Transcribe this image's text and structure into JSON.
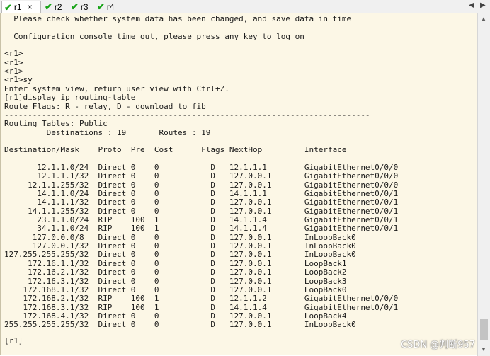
{
  "tabs": [
    {
      "label": "r1",
      "active": true,
      "close": "×"
    },
    {
      "label": "r2"
    },
    {
      "label": "r3"
    },
    {
      "label": "r4"
    }
  ],
  "nav": {
    "left": "◀",
    "right": "▶"
  },
  "terminal": {
    "lines": [
      "  Please check whether system data has been changed, and save data in time",
      "",
      "  Configuration console time out, please press any key to log on",
      "",
      "<r1>",
      "<r1>",
      "<r1>",
      "<r1>sy",
      "Enter system view, return user view with Ctrl+Z.",
      "[r1]display ip routing-table",
      "Route Flags: R - relay, D - download to fib",
      "------------------------------------------------------------------------------",
      "Routing Tables: Public",
      "         Destinations : 19       Routes : 19",
      "",
      "Destination/Mask    Proto  Pre  Cost      Flags NextHop         Interface",
      "",
      "       12.1.1.0/24  Direct 0    0           D   12.1.1.1        GigabitEthernet0/0/0",
      "       12.1.1.1/32  Direct 0    0           D   127.0.0.1       GigabitEthernet0/0/0",
      "     12.1.1.255/32  Direct 0    0           D   127.0.0.1       GigabitEthernet0/0/0",
      "       14.1.1.0/24  Direct 0    0           D   14.1.1.1        GigabitEthernet0/0/1",
      "       14.1.1.1/32  Direct 0    0           D   127.0.0.1       GigabitEthernet0/0/1",
      "     14.1.1.255/32  Direct 0    0           D   127.0.0.1       GigabitEthernet0/0/1",
      "       23.1.1.0/24  RIP    100  1           D   14.1.1.4        GigabitEthernet0/0/1",
      "       34.1.1.0/24  RIP    100  1           D   14.1.1.4        GigabitEthernet0/0/1",
      "      127.0.0.0/8   Direct 0    0           D   127.0.0.1       InLoopBack0",
      "      127.0.0.1/32  Direct 0    0           D   127.0.0.1       InLoopBack0",
      "127.255.255.255/32  Direct 0    0           D   127.0.0.1       InLoopBack0",
      "     172.16.1.1/32  Direct 0    0           D   127.0.0.1       LoopBack1",
      "     172.16.2.1/32  Direct 0    0           D   127.0.0.1       LoopBack2",
      "     172.16.3.1/32  Direct 0    0           D   127.0.0.1       LoopBack3",
      "    172.168.1.1/32  Direct 0    0           D   127.0.0.1       LoopBack0",
      "    172.168.2.1/32  RIP    100  1           D   12.1.1.2        GigabitEthernet0/0/0",
      "    172.168.3.1/32  RIP    100  1           D   14.1.1.4        GigabitEthernet0/0/1",
      "    172.168.4.1/32  Direct 0    0           D   127.0.0.1       LoopBack4",
      "255.255.255.255/32  Direct 0    0           D   127.0.0.1       InLoopBack0",
      "",
      "",
      "[r1]"
    ]
  },
  "watermark": "CSDN @判断957"
}
